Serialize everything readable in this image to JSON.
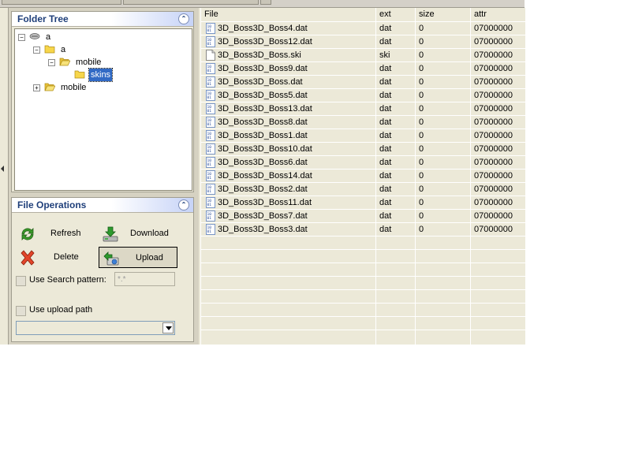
{
  "folder_tree": {
    "title": "Folder Tree",
    "nodes": [
      {
        "label": "a",
        "icon": "drive-icon",
        "expander": "−"
      },
      {
        "label": "a",
        "icon": "folder-icon",
        "expander": "−"
      },
      {
        "label": "mobile",
        "icon": "open-folder-icon",
        "expander": "−"
      },
      {
        "label": "skins",
        "icon": "folder-icon",
        "expander": "",
        "selected": true
      },
      {
        "label": "mobile",
        "icon": "open-folder-icon",
        "expander": "+"
      }
    ]
  },
  "file_operations": {
    "title": "File Operations",
    "refresh_label": "Refresh",
    "download_label": "Download",
    "delete_label": "Delete",
    "upload_label": "Upload",
    "use_search_pattern_label": "Use Search pattern:",
    "search_pattern_value": "*.*",
    "use_upload_path_label": "Use upload path",
    "upload_path_value": ""
  },
  "file_list": {
    "columns": [
      "File",
      "ext",
      "size",
      "attr"
    ],
    "rows": [
      {
        "file": "3D_Boss3D_Boss4.dat",
        "ext": "dat",
        "size": "0",
        "attr": "07000000"
      },
      {
        "file": "3D_Boss3D_Boss12.dat",
        "ext": "dat",
        "size": "0",
        "attr": "07000000"
      },
      {
        "file": "3D_Boss3D_Boss.ski",
        "ext": "ski",
        "size": "0",
        "attr": "07000000"
      },
      {
        "file": "3D_Boss3D_Boss9.dat",
        "ext": "dat",
        "size": "0",
        "attr": "07000000"
      },
      {
        "file": "3D_Boss3D_Boss.dat",
        "ext": "dat",
        "size": "0",
        "attr": "07000000"
      },
      {
        "file": "3D_Boss3D_Boss5.dat",
        "ext": "dat",
        "size": "0",
        "attr": "07000000"
      },
      {
        "file": "3D_Boss3D_Boss13.dat",
        "ext": "dat",
        "size": "0",
        "attr": "07000000"
      },
      {
        "file": "3D_Boss3D_Boss8.dat",
        "ext": "dat",
        "size": "0",
        "attr": "07000000"
      },
      {
        "file": "3D_Boss3D_Boss1.dat",
        "ext": "dat",
        "size": "0",
        "attr": "07000000"
      },
      {
        "file": "3D_Boss3D_Boss10.dat",
        "ext": "dat",
        "size": "0",
        "attr": "07000000"
      },
      {
        "file": "3D_Boss3D_Boss6.dat",
        "ext": "dat",
        "size": "0",
        "attr": "07000000"
      },
      {
        "file": "3D_Boss3D_Boss14.dat",
        "ext": "dat",
        "size": "0",
        "attr": "07000000"
      },
      {
        "file": "3D_Boss3D_Boss2.dat",
        "ext": "dat",
        "size": "0",
        "attr": "07000000"
      },
      {
        "file": "3D_Boss3D_Boss11.dat",
        "ext": "dat",
        "size": "0",
        "attr": "07000000"
      },
      {
        "file": "3D_Boss3D_Boss7.dat",
        "ext": "dat",
        "size": "0",
        "attr": "07000000"
      },
      {
        "file": "3D_Boss3D_Boss3.dat",
        "ext": "dat",
        "size": "0",
        "attr": "07000000"
      }
    ]
  },
  "colors": {
    "header_text": "#1f3f7a",
    "selection": "#316ac5",
    "panel_bg": "#ece9d8"
  }
}
